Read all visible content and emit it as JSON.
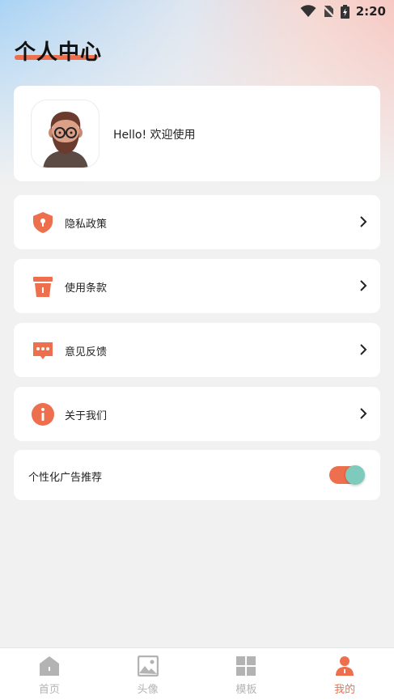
{
  "status_bar": {
    "time": "2:20"
  },
  "page_title": "个人中心",
  "profile": {
    "greeting": "Hello! 欢迎使用"
  },
  "menu": [
    {
      "label": "隐私政策",
      "icon": "shield-icon"
    },
    {
      "label": "使用条款",
      "icon": "terms-cup-icon"
    },
    {
      "label": "意见反馈",
      "icon": "chat-bubble-icon"
    },
    {
      "label": "关于我们",
      "icon": "info-icon"
    }
  ],
  "ad_setting": {
    "label": "个性化广告推荐",
    "enabled": true
  },
  "bottom_nav": [
    {
      "label": "首页",
      "icon": "home-icon",
      "active": false
    },
    {
      "label": "头像",
      "icon": "image-icon",
      "active": false
    },
    {
      "label": "模板",
      "icon": "grid-icon",
      "active": false
    },
    {
      "label": "我的",
      "icon": "person-icon",
      "active": true
    }
  ],
  "colors": {
    "accent": "#ee6f4d",
    "toggle_knob": "#7ecbbd",
    "inactive": "#b3b3b3",
    "background": "#f1f1f1"
  }
}
